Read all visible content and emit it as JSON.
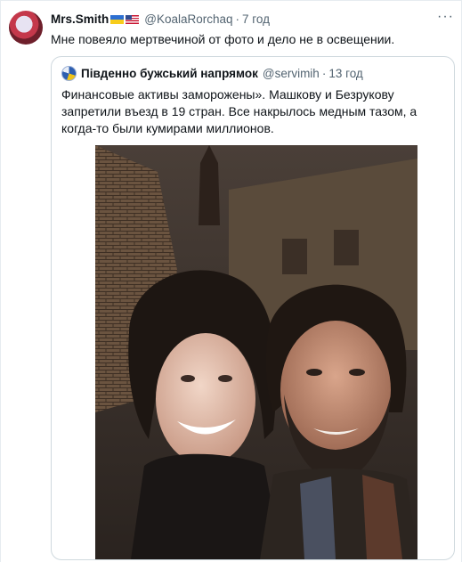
{
  "tweet": {
    "author_name": "Mrs.Smith",
    "author_flags": [
      "flag-ukraine-icon",
      "flag-usa-icon"
    ],
    "handle": "@KoalaRorchaq",
    "separator": "·",
    "time": "7 год",
    "text": "Мне повеяло мертвечиной от фото и дело не в освещении.",
    "more_icon": "more-icon"
  },
  "quoted": {
    "author_name": "Південно бужський напрямок",
    "handle": "@servimih",
    "separator": "·",
    "time": "13 год",
    "text": "Финансовые активы заморожены». Машкову и Безрукову запретили въезд в 19 стран. Все накрылось медным тазом, а когда-то были кумирами миллионов."
  },
  "colors": {
    "text": "#0f1419",
    "secondary": "#536471",
    "border": "#cfd9de"
  }
}
